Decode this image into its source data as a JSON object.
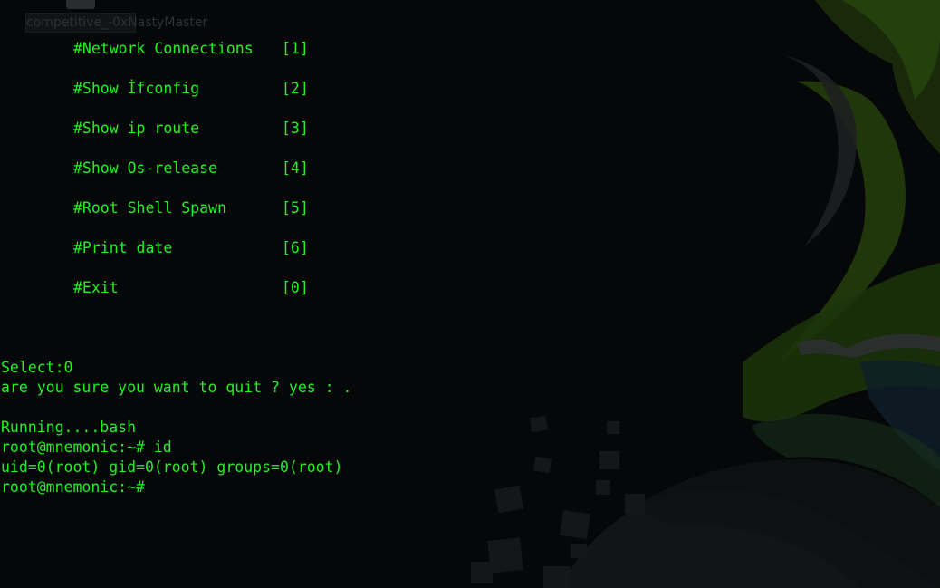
{
  "desktop": {
    "icon_label": "competitive_-0xNastyMaster"
  },
  "menu": {
    "items": [
      {
        "label": "#Network Connections",
        "key": "[1]"
      },
      {
        "label": "#Show İfconfig",
        "key": "[2]"
      },
      {
        "label": "#Show ip route",
        "key": "[3]"
      },
      {
        "label": "#Show Os-release",
        "key": "[4]"
      },
      {
        "label": "#Root Shell Spawn",
        "key": "[5]"
      },
      {
        "label": "#Print date",
        "key": "[6]"
      },
      {
        "label": "#Exit",
        "key": "[0]"
      }
    ]
  },
  "output": {
    "select": "Select:0",
    "confirm": "are you sure you want to quit ? yes : .",
    "running": "Running....bash",
    "cmd1": "root@mnemonic:~# id",
    "id_result": "uid=0(root) gid=0(root) groups=0(root)",
    "prompt": "root@mnemonic:~#"
  },
  "colors": {
    "terminal_text": "#23ef23",
    "background": "#060708",
    "wallpaper_green": "#1b3a0c"
  }
}
